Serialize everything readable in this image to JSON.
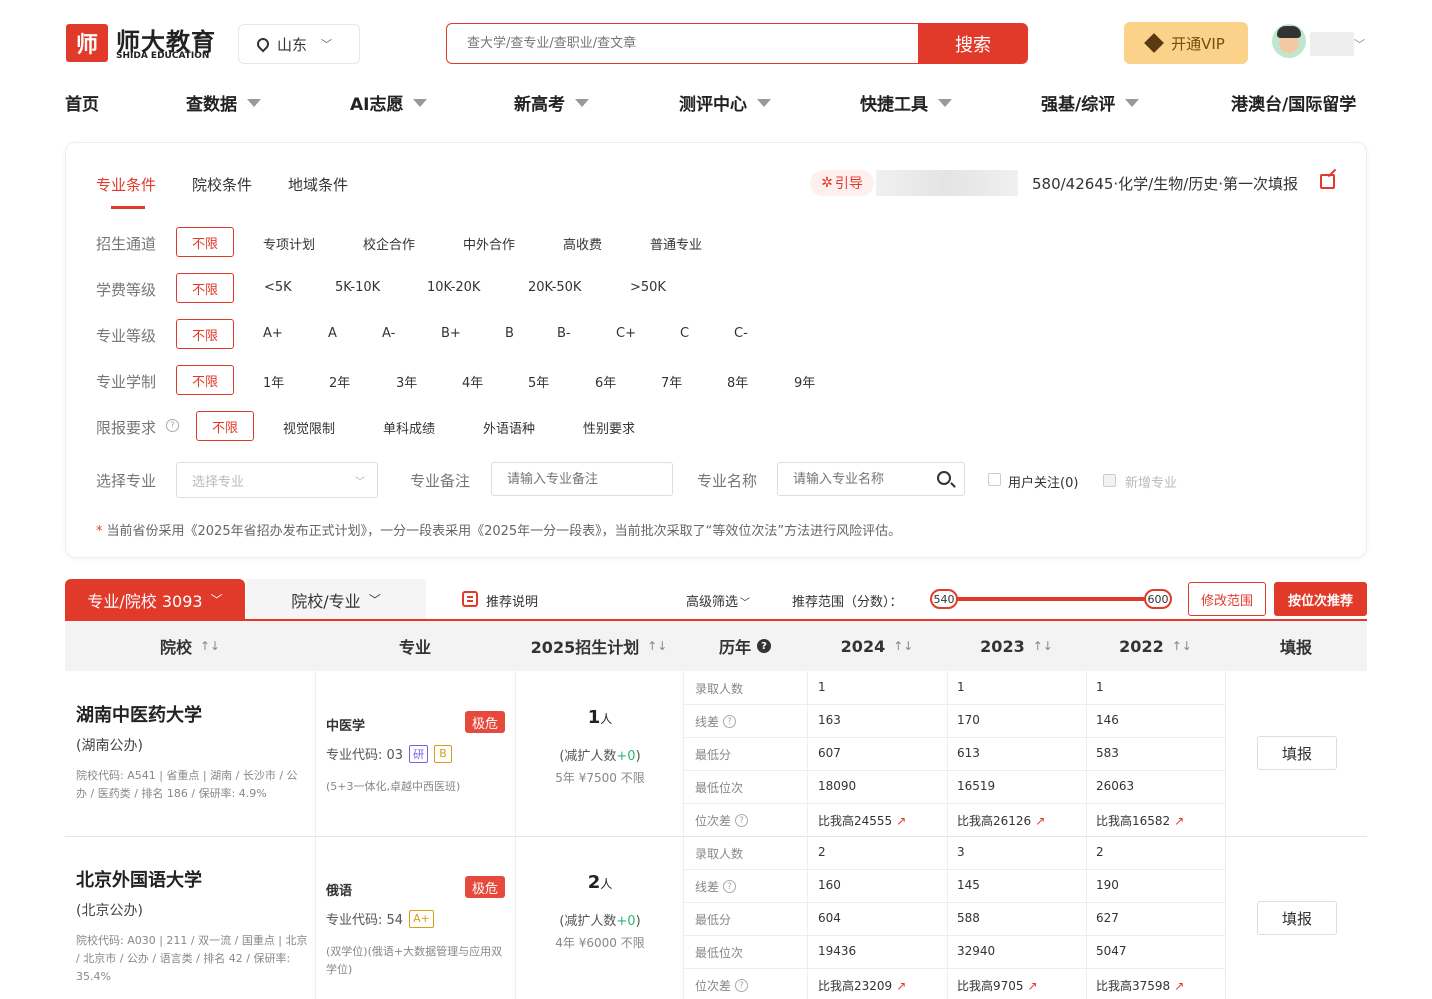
{
  "header": {
    "logo_mark": "师",
    "logo_cn": "师大教育",
    "logo_en": "SHIDA EDUCATION",
    "region": "山东",
    "search_placeholder": "查大学/查专业/查职业/查文章",
    "search_button": "搜索",
    "vip_button": "开通VIP"
  },
  "nav": {
    "items": [
      {
        "label": "首页",
        "dropdown": false
      },
      {
        "label": "查数据",
        "dropdown": true
      },
      {
        "label": "AI志愿",
        "dropdown": true
      },
      {
        "label": "新高考",
        "dropdown": true
      },
      {
        "label": "测评中心",
        "dropdown": true
      },
      {
        "label": "快捷工具",
        "dropdown": true
      },
      {
        "label": "强基/综评",
        "dropdown": true
      },
      {
        "label": "港澳台/国际留学",
        "dropdown": false
      }
    ]
  },
  "filter": {
    "tabs": [
      "专业条件",
      "院校条件",
      "地域条件"
    ],
    "guide_label": "引导",
    "info_text": "580/42645·化学/生物/历史·第一次填报",
    "rows": [
      {
        "label": "招生通道",
        "selected": "不限",
        "options": [
          "专项计划",
          "校企合作",
          "中外合作",
          "高收费",
          "普通专业"
        ]
      },
      {
        "label": "学费等级",
        "selected": "不限",
        "options": [
          "<5K",
          "5K-10K",
          "10K-20K",
          "20K-50K",
          ">50K"
        ]
      },
      {
        "label": "专业等级",
        "selected": "不限",
        "options": [
          "A+",
          "A",
          "A-",
          "B+",
          "B",
          "B-",
          "C+",
          "C",
          "C-"
        ]
      },
      {
        "label": "专业学制",
        "selected": "不限",
        "options": [
          "1年",
          "2年",
          "3年",
          "4年",
          "5年",
          "6年",
          "7年",
          "8年",
          "9年"
        ]
      },
      {
        "label": "限报要求",
        "selected": "不限",
        "options": [
          "视觉限制",
          "单科成绩",
          "外语语种",
          "性别要求"
        ]
      }
    ],
    "select_major_label": "选择专业",
    "select_major_placeholder": "选择专业",
    "major_note_label": "专业备注",
    "major_note_placeholder": "请输入专业备注",
    "major_name_label": "专业名称",
    "major_name_placeholder": "请输入专业名称",
    "user_follow": "用户关注(0)",
    "new_major": "新增专业",
    "note": "当前省份采用《2025年省招办发布正式计划》，一分一段表采用《2025年一分一段表》，当前批次采取了“等效位次法”方法进行风险评估。"
  },
  "results": {
    "tab_active": "专业/院校 3093",
    "tab_other": "院校/专业",
    "recommend_note": "推荐说明",
    "advanced_filter": "高级筛选",
    "range_label": "推荐范围（分数）：",
    "range_min": "540",
    "range_max": "600",
    "modify_range": "修改范围",
    "rank_recommend": "按位次推荐"
  },
  "table": {
    "headers": [
      "院校",
      "专业",
      "2025招生计划",
      "历年",
      "2024",
      "2023",
      "2022",
      "填报"
    ],
    "hist_labels": [
      "录取人数",
      "线差",
      "最低分",
      "最低位次",
      "位次差"
    ],
    "rows": [
      {
        "university": "湖南中医药大学",
        "type": "(湖南公办)",
        "meta": "院校代码: A541 |  省重点 |  湖南 / 长沙市 / 公办 / 医药类 / 排名 186 / 保研率: 4.9%",
        "major": "中医学",
        "risk": "极危",
        "code": "专业代码: 03",
        "tags": [
          {
            "text": "研",
            "color": "#7a5cf0"
          },
          {
            "text": "B",
            "color": "#d4a017"
          }
        ],
        "major_note": "(5+3一体化,卓越中西医班)",
        "plan_count": "1",
        "plan_unit": "人",
        "plan_change_prefix": "(减扩人数",
        "plan_change_value": "+0",
        "plan_change_suffix": ")",
        "plan_fee": "5年 ¥7500 不限",
        "years": [
          [
            "1",
            "163",
            "607",
            "18090",
            "比我高24555"
          ],
          [
            "1",
            "170",
            "613",
            "16519",
            "比我高26126"
          ],
          [
            "1",
            "146",
            "583",
            "26063",
            "比我高16582"
          ]
        ],
        "fill": "填报"
      },
      {
        "university": "北京外国语大学",
        "type": "(北京公办)",
        "meta": "院校代码: A030 |  211 / 双一流 / 国重点 |  北京 / 北京市 / 公办 / 语言类 / 排名 42 / 保研率: 35.4%",
        "major": "俄语",
        "risk": "极危",
        "code": "专业代码: 54",
        "tags": [
          {
            "text": "A+",
            "color": "#d4a017"
          }
        ],
        "major_note": "(双学位)(俄语+大数据管理与应用双学位)",
        "plan_count": "2",
        "plan_unit": "人",
        "plan_change_prefix": "(减扩人数",
        "plan_change_value": "+0",
        "plan_change_suffix": ")",
        "plan_fee": "4年 ¥6000 不限",
        "years": [
          [
            "2",
            "160",
            "604",
            "19436",
            "比我高23209"
          ],
          [
            "3",
            "145",
            "588",
            "32940",
            "比我高9705"
          ],
          [
            "2",
            "190",
            "627",
            "5047",
            "比我高37598"
          ]
        ],
        "fill": "填报"
      }
    ]
  },
  "colors": {
    "accent": "#e23a2a",
    "vip": "#fbd28a",
    "green": "#2bb673"
  }
}
